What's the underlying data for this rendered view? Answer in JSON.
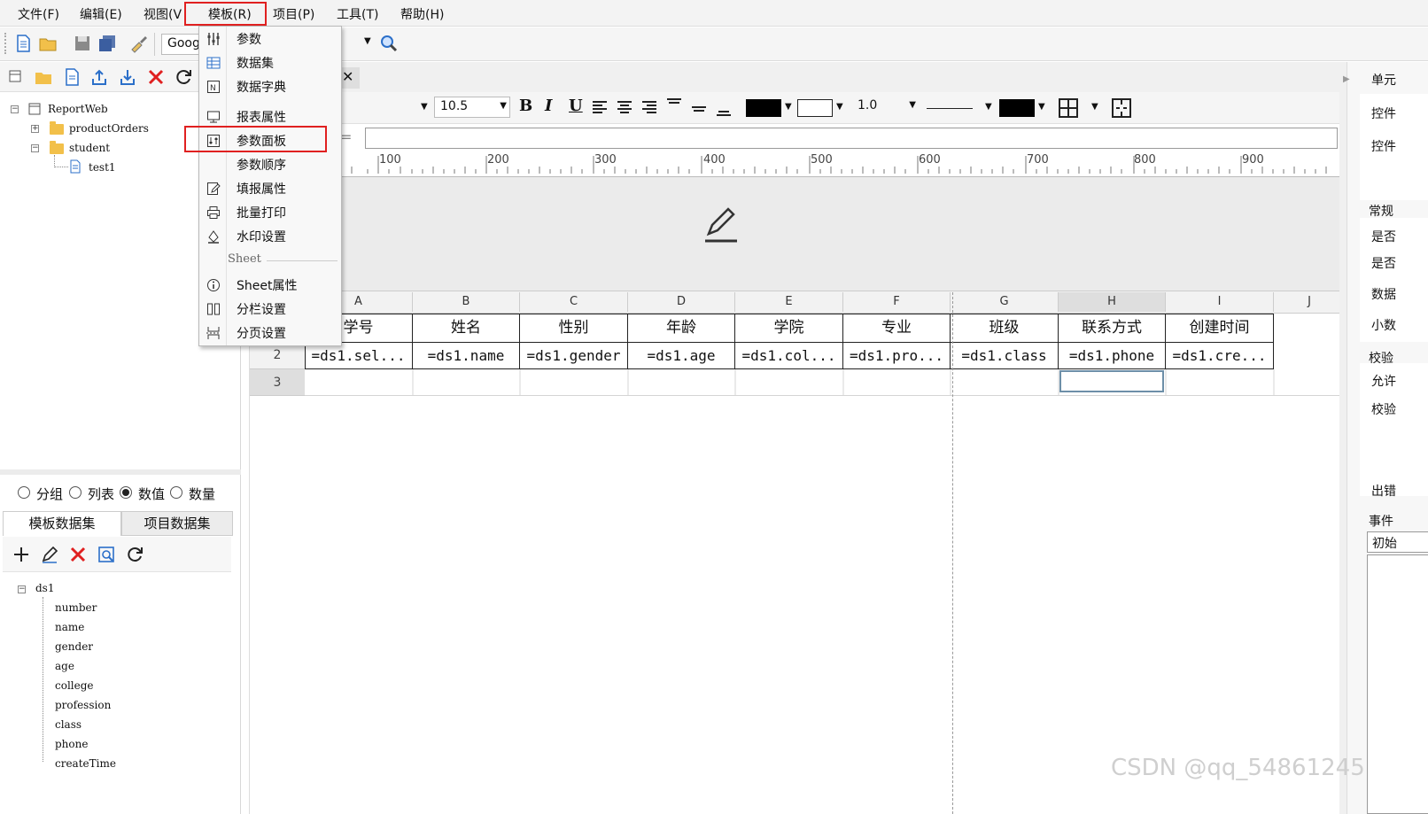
{
  "menubar": {
    "items": [
      "文件(F)",
      "编辑(E)",
      "视图(V",
      "模板(R)",
      "项目(P)",
      "工具(T)",
      "帮助(H)"
    ]
  },
  "toolbar": {
    "font_name": "Goog",
    "font_size": "10.5",
    "line_width": "1.0"
  },
  "dropdown": {
    "items": [
      "参数",
      "数据集",
      "数据字典",
      "报表属性",
      "参数面板",
      "参数顺序",
      "填报属性",
      "批量打印",
      "水印设置"
    ],
    "section": "Sheet",
    "sheet_items": [
      "Sheet属性",
      "分栏设置",
      "分页设置"
    ]
  },
  "file_tree": {
    "root": "ReportWeb",
    "nodes": [
      "productOrders",
      "student",
      "test1"
    ]
  },
  "dataset_panel": {
    "radio": [
      "分组",
      "列表",
      "数值",
      "数量"
    ],
    "selected": "数值",
    "tabs": [
      "模板数据集",
      "项目数据集"
    ],
    "dataset": "ds1",
    "fields": [
      "number",
      "name",
      "gender",
      "age",
      "college",
      "profession",
      "class",
      "phone",
      "createTime"
    ]
  },
  "ruler": [
    "100",
    "200",
    "300",
    "400",
    "500",
    "600",
    "700",
    "800",
    "900"
  ],
  "grid": {
    "columns": [
      "A",
      "B",
      "C",
      "D",
      "E",
      "F",
      "G",
      "H",
      "I",
      "J"
    ],
    "rows": [
      "2",
      "3"
    ],
    "header_row": [
      "学号",
      "姓名",
      "性别",
      "年龄",
      "学院",
      "专业",
      "班级",
      "联系方式",
      "创建时间"
    ],
    "data_row": [
      "=ds1.sel...",
      "=ds1.name",
      "=ds1.gender",
      "=ds1.age",
      "=ds1.col...",
      "=ds1.pro...",
      "=ds1.class",
      "=ds1.phone",
      "=ds1.cre..."
    ]
  },
  "right_panel": {
    "items": [
      "单元",
      "控件",
      "控件",
      "常规",
      "是否",
      "是否",
      "数据",
      "小数",
      "校验",
      "允许",
      "校验",
      "出错",
      "事件",
      "初始"
    ]
  },
  "watermark": "CSDN @qq_54861245",
  "colors": {
    "highlight": "#e02020",
    "folder": "#f2c04a",
    "icon_blue": "#2b6fc9"
  }
}
